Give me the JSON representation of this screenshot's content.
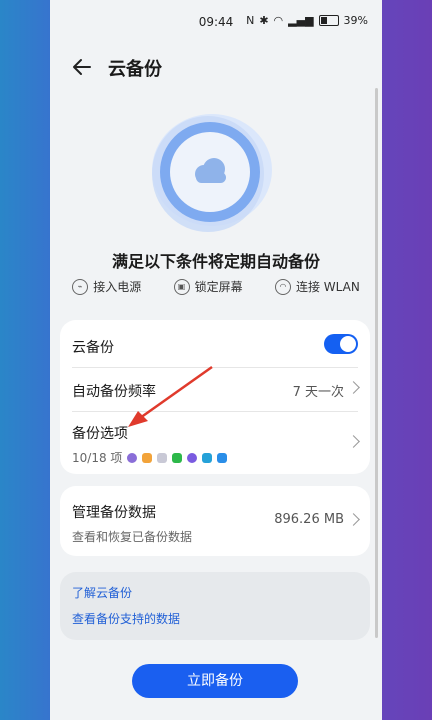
{
  "status": {
    "time": "09:44",
    "battery": "39%"
  },
  "header": {
    "title": "云备份"
  },
  "hero": {
    "title": "满足以下条件将定期自动备份"
  },
  "conditions": [
    {
      "label": "接入电源",
      "icon": "plug-icon"
    },
    {
      "label": "锁定屏幕",
      "icon": "lock-icon"
    },
    {
      "label": "连接 WLAN",
      "icon": "wifi-icon"
    }
  ],
  "settings": {
    "cloud_backup": {
      "label": "云备份",
      "enabled": true
    },
    "frequency": {
      "label": "自动备份频率",
      "value": "7 天一次"
    },
    "options": {
      "label": "备份选项",
      "count": "10/18 项"
    }
  },
  "manage": {
    "label": "管理备份数据",
    "subtitle": "查看和恢复已备份数据",
    "size": "896.26 MB"
  },
  "info": {
    "learn": "了解云备份",
    "supported": "查看备份支持的数据"
  },
  "action": {
    "backup_now": "立即备份"
  },
  "colors": {
    "accent": "#1a5ff0",
    "annotation": "#e03a2c"
  }
}
